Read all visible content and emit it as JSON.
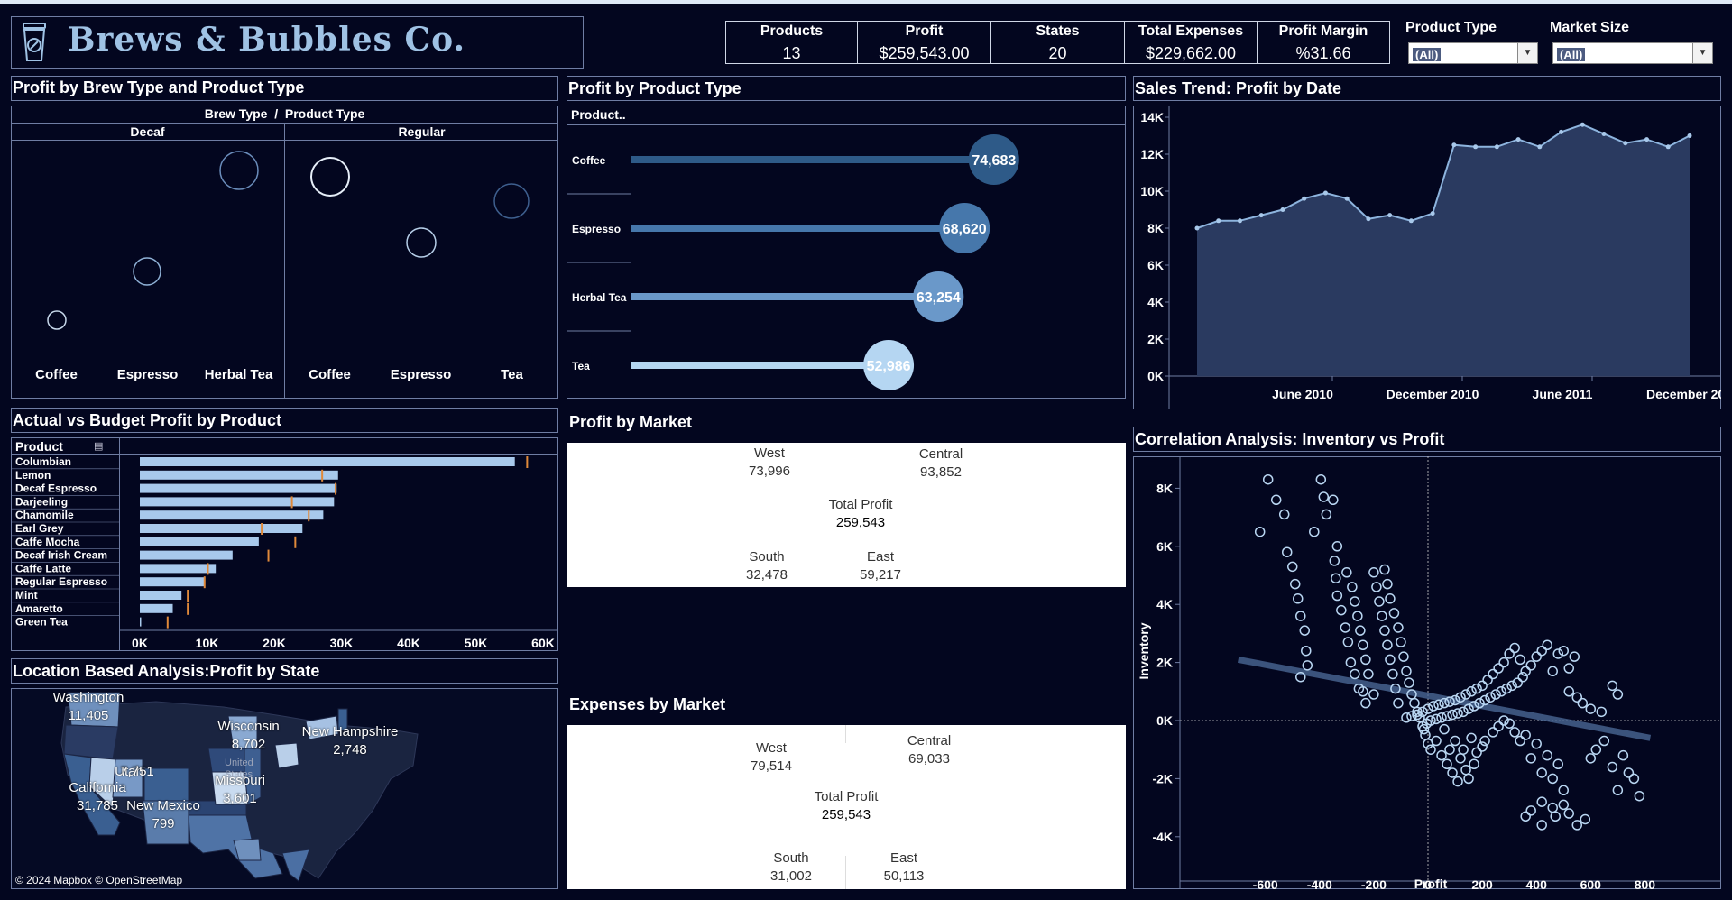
{
  "header": {
    "title": "Brews & Bubbles Co.",
    "logo_icon": "coffee-cup-icon",
    "kpis": [
      {
        "label": "Products",
        "value": "13"
      },
      {
        "label": "Profit",
        "value": "$259,543.00"
      },
      {
        "label": "States",
        "value": "20"
      },
      {
        "label": "Total Expenses",
        "value": "$229,662.00"
      },
      {
        "label": "Profit Margin",
        "value": "%31.66"
      }
    ],
    "filters": [
      {
        "label": "Product Type",
        "value": "(All)"
      },
      {
        "label": "Market Size",
        "value": "(All)"
      }
    ]
  },
  "brew_panel": {
    "title": "Profit by Brew Type and Product Type",
    "header": "Brew Type  /  Product Type",
    "groups": [
      {
        "name": "Decaf",
        "items": [
          "Coffee",
          "Espresso",
          "Herbal Tea"
        ]
      },
      {
        "name": "Regular",
        "items": [
          "Coffee",
          "Espresso",
          "Tea"
        ]
      }
    ]
  },
  "product_panel": {
    "title": "Profit by Product Type",
    "column_header": "Product..",
    "rows": [
      {
        "label": "Coffee",
        "value": 74683,
        "display": "74,683",
        "color": "#2e5a88"
      },
      {
        "label": "Espresso",
        "value": 68620,
        "display": "68,620",
        "color": "#4677ab"
      },
      {
        "label": "Herbal Tea",
        "value": 63254,
        "display": "63,254",
        "color": "#6a98c9"
      },
      {
        "label": "Tea",
        "value": 52986,
        "display": "52,986",
        "color": "#b5d6f2"
      }
    ]
  },
  "trend_panel": {
    "title": "Sales Trend: Profit by Date",
    "y_ticks": [
      "14K",
      "12K",
      "10K",
      "8K",
      "6K",
      "4K",
      "2K",
      "0K"
    ],
    "x_ticks": [
      "June 2010",
      "December 2010",
      "June 2011",
      "December 2011"
    ]
  },
  "budget_panel": {
    "title": "Actual vs Budget Profit by Product",
    "column_header": "Product",
    "sort_icon": "sort-descending-icon",
    "x_ticks": [
      "0K",
      "10K",
      "20K",
      "30K",
      "40K",
      "50K",
      "60K"
    ]
  },
  "market_panel": {
    "title": "Profit by Market",
    "west": {
      "label": "West",
      "value": "73,996"
    },
    "central": {
      "label": "Central",
      "value": "93,852"
    },
    "total": {
      "label": "Total Profit",
      "value": "259,543"
    },
    "south": {
      "label": "South",
      "value": "32,478"
    },
    "east": {
      "label": "East",
      "value": "59,217"
    }
  },
  "expenses_panel": {
    "title": "Expenses by Market",
    "west": {
      "label": "West",
      "value": "79,514"
    },
    "central": {
      "label": "Central",
      "value": "69,033"
    },
    "total": {
      "label": "Total Profit",
      "value": "259,543"
    },
    "south": {
      "label": "South",
      "value": "31,002"
    },
    "east": {
      "label": "East",
      "value": "50,113"
    }
  },
  "map_panel": {
    "title": "Location Based Analysis:Profit by State",
    "country_label": "United States",
    "states": [
      {
        "name": "Washington",
        "value": "11,405"
      },
      {
        "name": "Wisconsin",
        "value": "8,702"
      },
      {
        "name": "New Hampshire",
        "value": "2,748"
      },
      {
        "name": "Utah",
        "value": "7,751"
      },
      {
        "name": "California",
        "value": "31,785"
      },
      {
        "name": "Missouri",
        "value": "3,601"
      },
      {
        "name": "New Mexico",
        "value": "799"
      }
    ],
    "attribution": "© 2024 Mapbox © OpenStreetMap"
  },
  "scatter_panel": {
    "title": "Correlation Analysis: Inventory vs Profit",
    "ylabel": "Inventory",
    "xlabel": "Profit",
    "y_ticks": [
      "8K",
      "6K",
      "4K",
      "2K",
      "0K",
      "-2K",
      "-4K"
    ],
    "x_ticks": [
      "-600",
      "-400",
      "-200",
      "0",
      "200",
      "400",
      "600",
      "800"
    ]
  },
  "chart_data": [
    {
      "type": "bar",
      "title": "Profit by Product Type",
      "categories": [
        "Coffee",
        "Espresso",
        "Herbal Tea",
        "Tea"
      ],
      "values": [
        74683,
        68620,
        63254,
        52986
      ]
    },
    {
      "type": "area",
      "title": "Sales Trend: Profit by Date",
      "x": [
        "Jan 2010",
        "Feb 2010",
        "Mar 2010",
        "Apr 2010",
        "May 2010",
        "Jun 2010",
        "Jul 2010",
        "Aug 2010",
        "Sep 2010",
        "Oct 2010",
        "Nov 2010",
        "Dec 2010",
        "Jan 2011",
        "Feb 2011",
        "Mar 2011",
        "Apr 2011",
        "May 2011",
        "Jun 2011",
        "Jul 2011",
        "Aug 2011",
        "Sep 2011",
        "Oct 2011",
        "Nov 2011",
        "Dec 2011"
      ],
      "values": [
        8000,
        8400,
        8400,
        8700,
        9000,
        9600,
        9900,
        9600,
        8500,
        8700,
        8400,
        8800,
        12500,
        12400,
        12400,
        12800,
        12400,
        13200,
        13600,
        13100,
        12600,
        12800,
        12400,
        13000
      ],
      "ylim": [
        0,
        14000
      ],
      "ylabel": "",
      "grid": false
    },
    {
      "type": "bar",
      "title": "Actual vs Budget Profit by Product",
      "orientation": "horizontal",
      "categories": [
        "Columbian",
        "Lemon",
        "Decaf Espresso",
        "Darjeeling",
        "Chamomile",
        "Earl Grey",
        "Caffe Mocha",
        "Decaf Irish Cream",
        "Caffe Latte",
        "Regular Espresso",
        "Mint",
        "Amaretto",
        "Green Tea"
      ],
      "series": [
        {
          "values": [
            55800,
            29500,
            29300,
            28900,
            27300,
            24200,
            17700,
            13800,
            11300,
            9700,
            6200,
            4900,
            200
          ]
        },
        {
          "values": [
            57500,
            27000,
            29000,
            22500,
            25000,
            18000,
            23000,
            19000,
            10000,
            9500,
            7000,
            7000,
            4000
          ]
        }
      ],
      "xlim": [
        0,
        60000
      ]
    },
    {
      "type": "scatter",
      "title": "Correlation Analysis: Inventory vs Profit",
      "xlabel": "Profit",
      "ylabel": "Inventory",
      "xlim": [
        -700,
        820
      ],
      "ylim": [
        -4200,
        8500
      ],
      "points": [
        [
          -620,
          6500
        ],
        [
          -590,
          8300
        ],
        [
          -560,
          7600
        ],
        [
          -530,
          7100
        ],
        [
          -520,
          5800
        ],
        [
          -500,
          5300
        ],
        [
          -490,
          4700
        ],
        [
          -480,
          4200
        ],
        [
          -470,
          3600
        ],
        [
          -455,
          3100
        ],
        [
          -450,
          2400
        ],
        [
          -445,
          1900
        ],
        [
          -470,
          1500
        ],
        [
          -420,
          6500
        ],
        [
          -395,
          8300
        ],
        [
          -385,
          7700
        ],
        [
          -375,
          7100
        ],
        [
          -350,
          7600
        ],
        [
          -335,
          6000
        ],
        [
          -345,
          5500
        ],
        [
          -340,
          4900
        ],
        [
          -335,
          4300
        ],
        [
          -320,
          3800
        ],
        [
          -305,
          3200
        ],
        [
          -295,
          2700
        ],
        [
          -285,
          2000
        ],
        [
          -270,
          1600
        ],
        [
          -255,
          1100
        ],
        [
          -240,
          1000
        ],
        [
          -230,
          600
        ],
        [
          -200,
          900
        ],
        [
          -300,
          5100
        ],
        [
          -280,
          4600
        ],
        [
          -270,
          4100
        ],
        [
          -260,
          3600
        ],
        [
          -250,
          3100
        ],
        [
          -240,
          2600
        ],
        [
          -230,
          2100
        ],
        [
          -220,
          1600
        ],
        [
          -200,
          5100
        ],
        [
          -190,
          4600
        ],
        [
          -180,
          4100
        ],
        [
          -170,
          3600
        ],
        [
          -160,
          3100
        ],
        [
          -150,
          2600
        ],
        [
          -140,
          2100
        ],
        [
          -130,
          1600
        ],
        [
          -120,
          1100
        ],
        [
          -110,
          600
        ],
        [
          -160,
          5200
        ],
        [
          -150,
          4700
        ],
        [
          -140,
          4200
        ],
        [
          -125,
          3700
        ],
        [
          -110,
          3200
        ],
        [
          -100,
          2700
        ],
        [
          -90,
          2200
        ],
        [
          -80,
          1700
        ],
        [
          -70,
          1300
        ],
        [
          -60,
          900
        ],
        [
          -50,
          600
        ],
        [
          -40,
          300
        ],
        [
          -30,
          100
        ],
        [
          -20,
          -200
        ],
        [
          -10,
          -500
        ],
        [
          0,
          -800
        ],
        [
          10,
          -1000
        ],
        [
          30,
          -700
        ],
        [
          50,
          -1200
        ],
        [
          60,
          -300
        ],
        [
          70,
          -1500
        ],
        [
          80,
          -1000
        ],
        [
          90,
          -1800
        ],
        [
          100,
          -700
        ],
        [
          110,
          -2100
        ],
        [
          120,
          -1300
        ],
        [
          130,
          -1000
        ],
        [
          140,
          -1700
        ],
        [
          150,
          -2000
        ],
        [
          160,
          -600
        ],
        [
          170,
          -1500
        ],
        [
          180,
          -1100
        ],
        [
          200,
          -900
        ],
        [
          210,
          -700
        ],
        [
          240,
          -400
        ],
        [
          260,
          -200
        ],
        [
          280,
          0
        ],
        [
          300,
          -100
        ],
        [
          320,
          -400
        ],
        [
          340,
          -700
        ],
        [
          360,
          -500
        ],
        [
          380,
          -1300
        ],
        [
          400,
          -800
        ],
        [
          420,
          -1800
        ],
        [
          440,
          -1200
        ],
        [
          460,
          -2000
        ],
        [
          480,
          -1500
        ],
        [
          500,
          -2400
        ],
        [
          520,
          -3200
        ],
        [
          550,
          -3600
        ],
        [
          580,
          -3400
        ],
        [
          600,
          -1300
        ],
        [
          620,
          -1000
        ],
        [
          650,
          -700
        ],
        [
          680,
          -1600
        ],
        [
          700,
          -2400
        ],
        [
          720,
          -1200
        ],
        [
          740,
          -1800
        ],
        [
          760,
          -2000
        ],
        [
          780,
          -2600
        ],
        [
          520,
          1000
        ],
        [
          550,
          800
        ],
        [
          570,
          600
        ],
        [
          600,
          400
        ],
        [
          640,
          300
        ],
        [
          680,
          1200
        ],
        [
          700,
          900
        ],
        [
          460,
          1700
        ],
        [
          480,
          2300
        ],
        [
          500,
          2400
        ],
        [
          520,
          1800
        ],
        [
          540,
          2200
        ],
        [
          420,
          2400
        ],
        [
          440,
          2600
        ],
        [
          400,
          2200
        ],
        [
          380,
          1900
        ],
        [
          360,
          1700
        ],
        [
          340,
          2100
        ],
        [
          320,
          2500
        ],
        [
          300,
          2300
        ],
        [
          280,
          2000
        ],
        [
          260,
          1800
        ],
        [
          240,
          1600
        ],
        [
          220,
          1400
        ],
        [
          200,
          1200
        ],
        [
          180,
          1100
        ],
        [
          160,
          1000
        ],
        [
          140,
          900
        ],
        [
          120,
          800
        ],
        [
          100,
          700
        ],
        [
          80,
          650
        ],
        [
          60,
          600
        ],
        [
          40,
          550
        ],
        [
          20,
          500
        ],
        [
          0,
          400
        ],
        [
          -20,
          300
        ],
        [
          -40,
          200
        ],
        [
          -60,
          150
        ],
        [
          -80,
          100
        ],
        [
          350,
          1500
        ],
        [
          330,
          1300
        ],
        [
          310,
          1200
        ],
        [
          290,
          1100
        ],
        [
          270,
          1000
        ],
        [
          250,
          900
        ],
        [
          230,
          800
        ],
        [
          210,
          700
        ],
        [
          190,
          600
        ],
        [
          170,
          500
        ],
        [
          150,
          400
        ],
        [
          130,
          300
        ],
        [
          110,
          250
        ],
        [
          90,
          200
        ],
        [
          70,
          150
        ],
        [
          50,
          100
        ],
        [
          30,
          50
        ],
        [
          10,
          0
        ],
        [
          -5,
          -100
        ],
        [
          -15,
          -300
        ],
        [
          420,
          -2800
        ],
        [
          500,
          -2900
        ],
        [
          470,
          -3300
        ],
        [
          360,
          -3300
        ],
        [
          380,
          -3100
        ],
        [
          420,
          -3600
        ],
        [
          460,
          -3000
        ]
      ],
      "trendline": [
        [
          -700,
          2100
        ],
        [
          820,
          -600
        ]
      ]
    }
  ]
}
